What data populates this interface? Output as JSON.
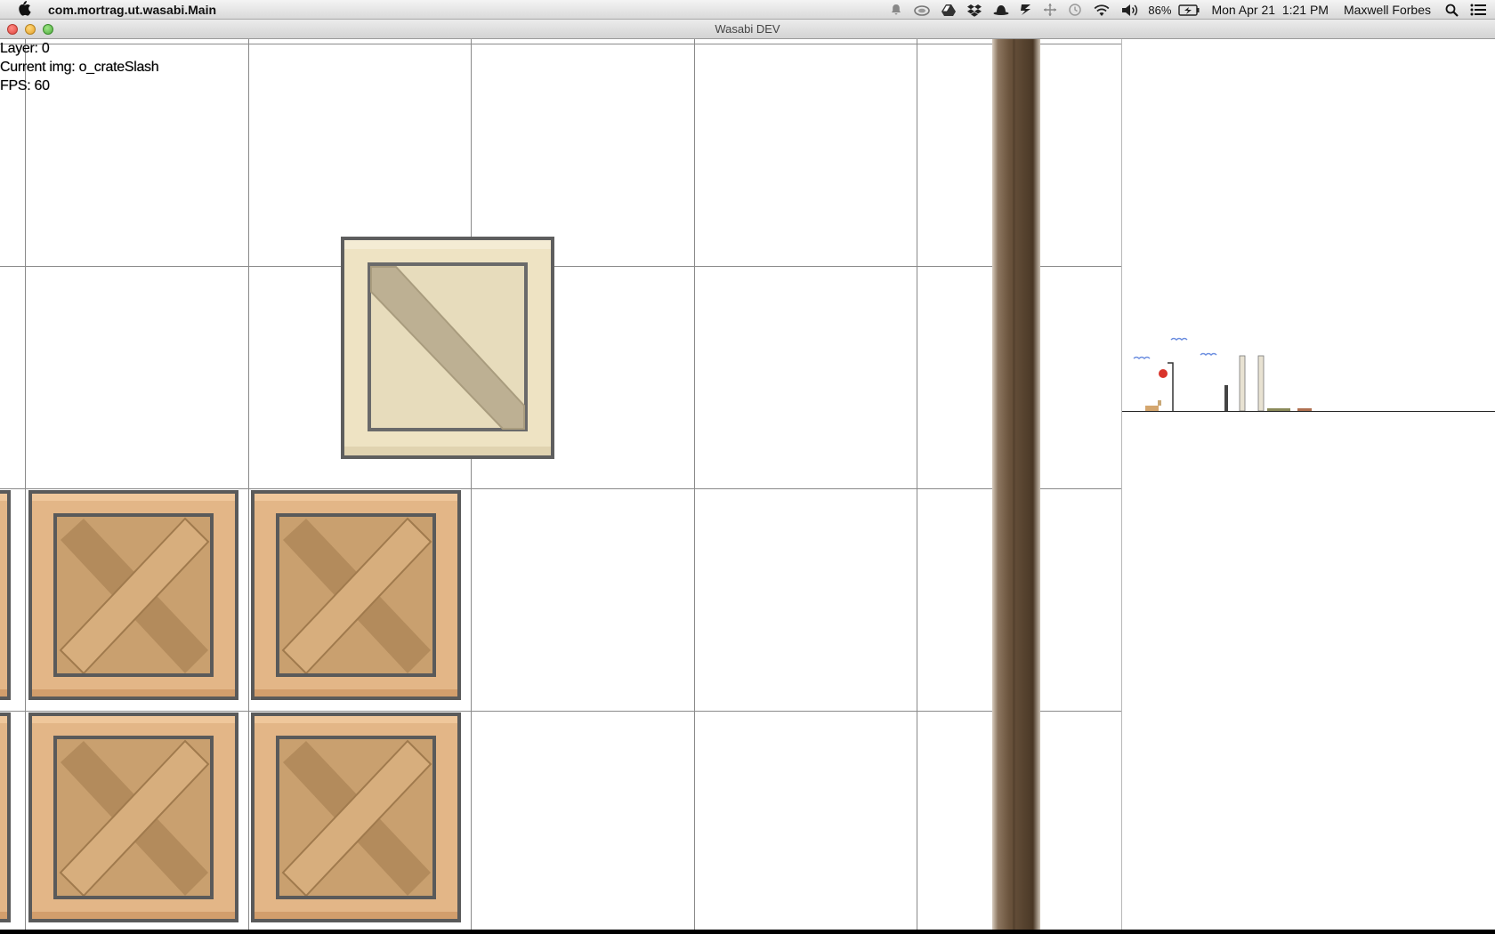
{
  "menubar": {
    "app_name": "com.mortrag.ut.wasabi.Main",
    "battery": "86%",
    "datetime": "Mon Apr 21  1:21 PM",
    "user": "Maxwell Forbes",
    "icons": [
      "apple-icon",
      "notification-icon",
      "cloud-app-icon",
      "google-drive-icon",
      "dropbox-icon",
      "alfred-hat-icon",
      "lightning-icon",
      "move-icon",
      "time-machine-icon",
      "wifi-icon",
      "volume-icon",
      "battery-icon",
      "spotlight-icon",
      "notification-center-icon"
    ]
  },
  "window": {
    "title": "Wasabi DEV"
  },
  "hud": {
    "layer": "Layer: 0",
    "current_img": "Current img: o_crateSlash",
    "fps": "FPS: 60"
  },
  "colors": {
    "crate_wood": "#e3b687",
    "crate_cross": "#b89263",
    "slash_crate_wood": "#eee3c3",
    "slash_crate_bar": "#bdb093",
    "crate_border": "#595959",
    "grid": "#8a8a8a",
    "post_wood": "#6b543d"
  }
}
